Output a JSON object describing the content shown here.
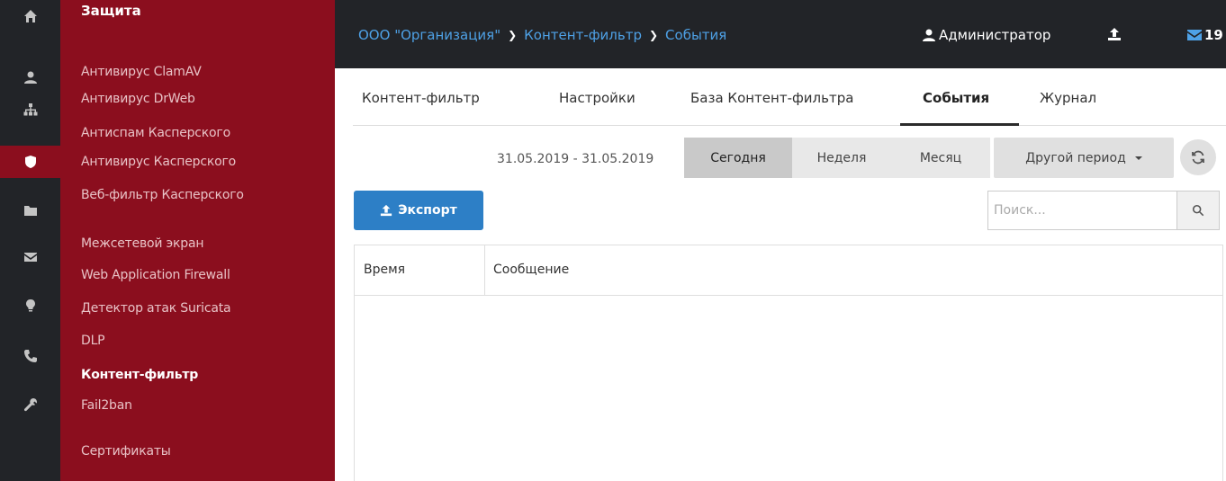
{
  "rail": {
    "icons": [
      "home-icon",
      "user-icon",
      "network-icon",
      "shield-icon",
      "folder-icon",
      "mail-icon",
      "bulb-icon",
      "phone-icon",
      "wrench-icon"
    ],
    "active_index": 3
  },
  "submenu": {
    "title": "Защита",
    "items": [
      {
        "label": "Антивирус ClamAV",
        "active": false
      },
      {
        "label": "Антивирус DrWeb",
        "active": false
      },
      {
        "label": "Антиспам Касперского",
        "active": false
      },
      {
        "label": "Антивирус Касперского",
        "active": false
      },
      {
        "label": "Веб-фильтр Касперского",
        "active": false
      },
      {
        "label": "Межсетевой экран",
        "active": false
      },
      {
        "label": "Web Application Firewall",
        "active": false
      },
      {
        "label": "Детектор атак Suricata",
        "active": false
      },
      {
        "label": "DLP",
        "active": false
      },
      {
        "label": "Контент-фильтр",
        "active": true
      },
      {
        "label": "Fail2ban",
        "active": false
      },
      {
        "label": "Сертификаты",
        "active": false
      }
    ]
  },
  "topbar": {
    "breadcrumb": [
      "ООО \"Организация\"",
      "Контент-фильтр",
      "События"
    ],
    "user": "Администратор",
    "mail_count": "19"
  },
  "tabs": [
    "Контент-фильтр",
    "Настройки",
    "База Контент-фильтра",
    "События",
    "Журнал"
  ],
  "active_tab": "События",
  "period": {
    "range": "31.05.2019 - 31.05.2019",
    "buttons": [
      "Сегодня",
      "Неделя",
      "Месяц"
    ],
    "active": "Сегодня",
    "other": "Другой период"
  },
  "export_label": "Экспорт",
  "search_placeholder": "Поиск...",
  "table": {
    "columns": [
      "Время",
      "Сообщение"
    ],
    "rows": []
  },
  "colors": {
    "sidebar_red": "#8b0e1e",
    "topbar": "#222428",
    "link": "#4ea1e6",
    "primary_button": "#2d7fc6"
  }
}
